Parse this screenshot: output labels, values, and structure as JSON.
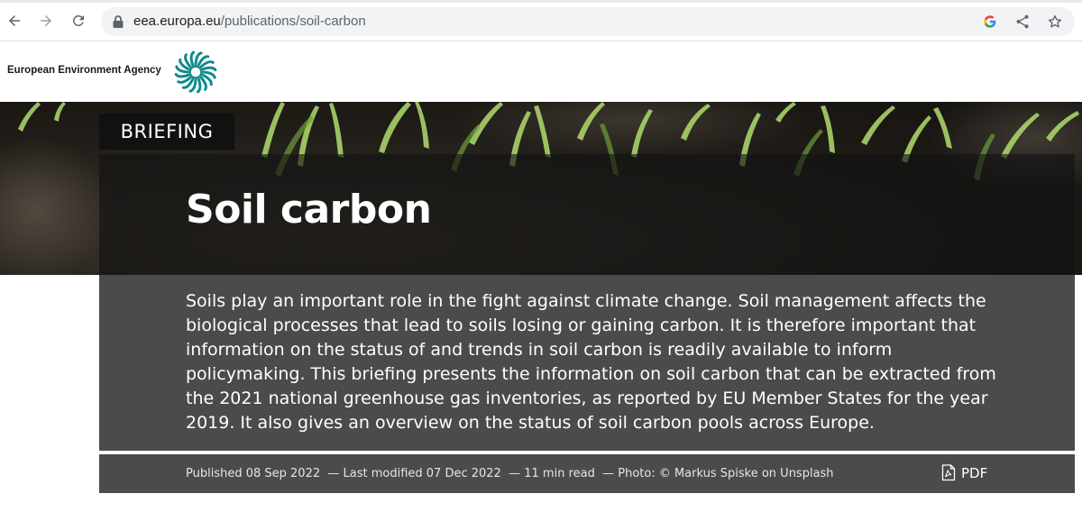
{
  "browser": {
    "url_domain": "eea.europa.eu",
    "url_path": "/publications/soil-carbon",
    "icons": [
      "back-arrow-icon",
      "forward-arrow-icon",
      "reload-icon",
      "lock-icon",
      "google-icon",
      "share-icon",
      "star-icon"
    ]
  },
  "site": {
    "brand_name": "European Environment Agency",
    "logo_icon": "eea-sun-logo-icon",
    "accent_color": "#0f8a8a"
  },
  "article": {
    "type_label": "BRIEFING",
    "title": "Soil carbon",
    "summary": "Soils play an important role in the fight against climate change. Soil management affects the biological processes that lead to soils losing or gaining carbon. It is therefore important that information on the status of and trends in soil carbon is readily available to inform policymaking. This briefing presents the information on soil carbon that can be extracted from the 2021 national greenhouse gas inventories, as reported by EU Member States for the year 2019. It also gives an overview on the status of soil carbon pools across Europe.",
    "meta": {
      "published": "Published 08 Sep 2022",
      "modified": "— Last modified 07 Dec 2022",
      "read_time": "— 11 min read",
      "photo": "— Photo: © Markus Spiske on Unsplash"
    },
    "pdf_label": "PDF"
  }
}
